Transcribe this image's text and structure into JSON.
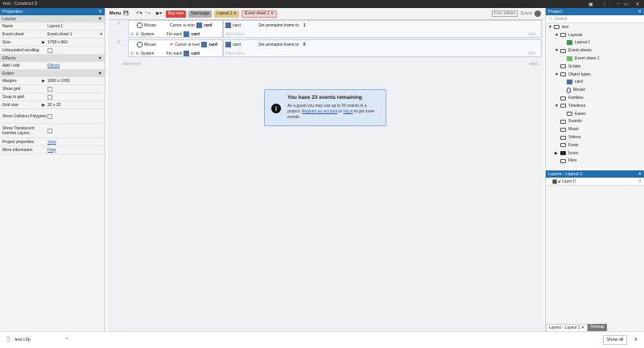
{
  "window": {
    "title": "test - Construct 3"
  },
  "properties": {
    "title": "Properties",
    "sections": [
      {
        "name": "Layout",
        "rows": [
          {
            "key": "Name",
            "value": "Layout 1"
          },
          {
            "key": "Event sheet",
            "value": "Event sheet 1"
          },
          {
            "key": "Size",
            "value": "1708 x 960"
          },
          {
            "key": "Unbounded scrolling",
            "value": ""
          }
        ]
      },
      {
        "name": "Effects",
        "rows": [
          {
            "key": "Add / edit",
            "value": "Effects"
          }
        ]
      },
      {
        "name": "Editor",
        "rows": [
          {
            "key": "Margins",
            "value": "1000 x 1000"
          },
          {
            "key": "Show grid",
            "value": ""
          },
          {
            "key": "Snap to grid",
            "value": ""
          },
          {
            "key": "Grid size",
            "value": "32 x 32"
          },
          {
            "key": "Show Collision Polygons",
            "value": ""
          },
          {
            "key": "Show Translucent Inactive Layers",
            "value": ""
          }
        ]
      }
    ],
    "footer": [
      {
        "key": "Project properties",
        "value": "View"
      },
      {
        "key": "More information",
        "value": "Help"
      }
    ]
  },
  "toolbar": {
    "menu": "Menu",
    "buy_now": "Buy now",
    "tabs": [
      "Start page",
      "Layout 1",
      "Event sheet 1"
    ],
    "free_edition": "Free edition",
    "guest": "Guest"
  },
  "events": [
    {
      "num": "1",
      "cond1_obj": "Mouse",
      "cond1_text": "Cursor is over",
      "cond1_target": "card",
      "cond2_obj": "System",
      "cond2_text": "For each",
      "cond2_target": "card",
      "act_obj": "card",
      "act_text_a": "Set animation frame to",
      "act_text_b": "1"
    },
    {
      "num": "2",
      "cond1_obj": "Mouse",
      "cond1_text": "Cursor is over",
      "cond1_target": "card",
      "cond2_obj": "System",
      "cond2_text": "For each",
      "cond2_target": "card",
      "act_obj": "card",
      "act_text_a": "Set animation frame to",
      "act_text_b": "0"
    }
  ],
  "event_labels": {
    "add_action": "Add action",
    "add_event": "Add event",
    "add": "Add..."
  },
  "notice": {
    "title": "You have 23 events remaining",
    "line1": "As a guest you may use up to 25 events in a",
    "line2_a": "project.",
    "register": "Register an account",
    "or": "or",
    "login": "log in",
    "line2_b": "to get more",
    "line3": "events."
  },
  "project": {
    "title": "Project",
    "search_placeholder": "Search",
    "tree": [
      {
        "label": "test",
        "indent": 0,
        "icon": "folder",
        "arrow": "▼"
      },
      {
        "label": "Layouts",
        "indent": 1,
        "icon": "folder",
        "arrow": "▼"
      },
      {
        "label": "Layout 1",
        "indent": 2,
        "icon": "layout",
        "arrow": ""
      },
      {
        "label": "Event sheets",
        "indent": 1,
        "icon": "folder",
        "arrow": "▼"
      },
      {
        "label": "Event sheet 1",
        "indent": 2,
        "icon": "eventsheet",
        "arrow": ""
      },
      {
        "label": "Scripts",
        "indent": 1,
        "icon": "folder",
        "arrow": ""
      },
      {
        "label": "Object types",
        "indent": 1,
        "icon": "folder",
        "arrow": "▼"
      },
      {
        "label": "card",
        "indent": 2,
        "icon": "sprite",
        "arrow": ""
      },
      {
        "label": "Mouse",
        "indent": 2,
        "icon": "mouse",
        "arrow": ""
      },
      {
        "label": "Families",
        "indent": 1,
        "icon": "folder",
        "arrow": ""
      },
      {
        "label": "Timelines",
        "indent": 1,
        "icon": "folder",
        "arrow": "▼"
      },
      {
        "label": "Eases",
        "indent": 2,
        "icon": "folder",
        "arrow": ""
      },
      {
        "label": "Sounds",
        "indent": 1,
        "icon": "folder",
        "arrow": ""
      },
      {
        "label": "Music",
        "indent": 1,
        "icon": "folder",
        "arrow": ""
      },
      {
        "label": "Videos",
        "indent": 1,
        "icon": "folder",
        "arrow": ""
      },
      {
        "label": "Fonts",
        "indent": 1,
        "icon": "folder",
        "arrow": ""
      },
      {
        "label": "Icons",
        "indent": 1,
        "icon": "folder-dark",
        "arrow": "▶"
      },
      {
        "label": "Files",
        "indent": 1,
        "icon": "folder",
        "arrow": ""
      }
    ]
  },
  "layers": {
    "title": "Layers - Layout 1",
    "layer": "Layer 0",
    "layer_num": "0",
    "tabs": [
      "Layers - Layout 1",
      "Tilemap"
    ]
  },
  "bottom": {
    "file": "test.c3p",
    "show_all": "Show all"
  },
  "colors": {
    "accent": "#1f6fb2",
    "buy": "#e0443e"
  }
}
